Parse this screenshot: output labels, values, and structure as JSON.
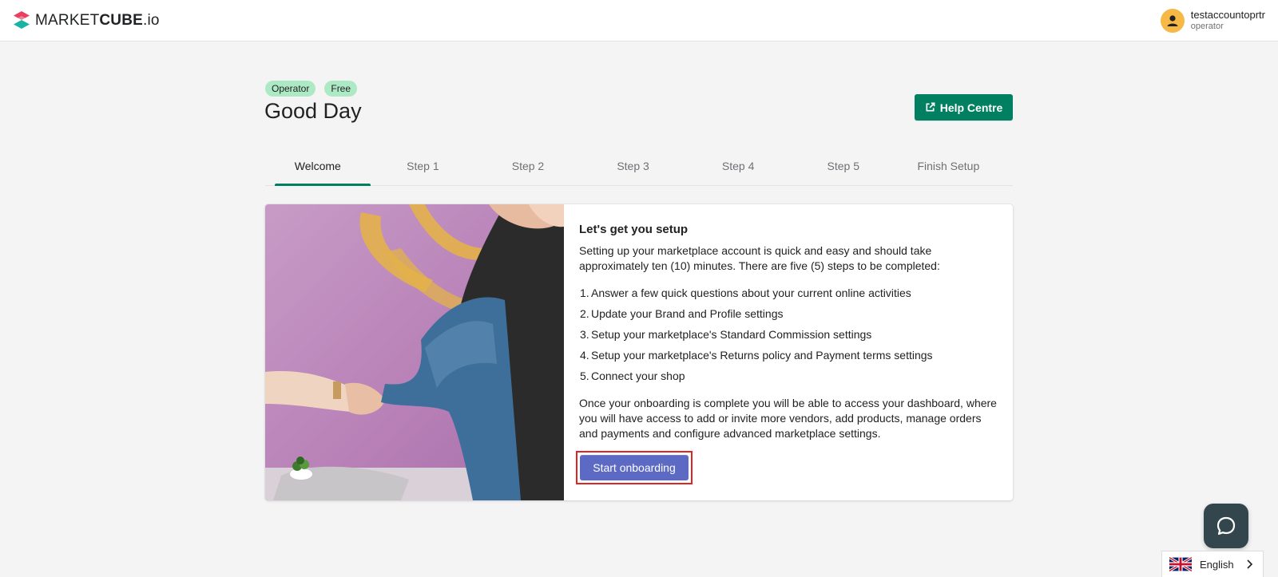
{
  "header": {
    "logo_regular": "MARKET",
    "logo_bold": "CUBE",
    "logo_suffix": ".io",
    "user_name": "testaccountoprtr",
    "user_role": "operator"
  },
  "page": {
    "badges": [
      "Operator",
      "Free"
    ],
    "title": "Good Day",
    "help_button_label": "Help Centre"
  },
  "tabs": [
    {
      "label": "Welcome",
      "active": true
    },
    {
      "label": "Step 1",
      "active": false
    },
    {
      "label": "Step 2",
      "active": false
    },
    {
      "label": "Step 3",
      "active": false
    },
    {
      "label": "Step 4",
      "active": false
    },
    {
      "label": "Step 5",
      "active": false
    },
    {
      "label": "Finish Setup",
      "active": false
    }
  ],
  "card": {
    "heading": "Let's get you setup",
    "intro": "Setting up your marketplace account is quick and easy and should take approximately ten (10) minutes. There are five (5) steps to be completed:",
    "steps": [
      {
        "num": "1.",
        "text": "Answer a few quick questions about your current online activities"
      },
      {
        "num": "2.",
        "text": "Update your Brand and Profile settings"
      },
      {
        "num": "3.",
        "text": "Setup your marketplace's Standard Commission settings"
      },
      {
        "num": "4.",
        "text": "Setup your marketplace's Returns policy and Payment terms settings"
      },
      {
        "num": "5.",
        "text": "Connect your shop"
      }
    ],
    "outro": "Once your onboarding is complete you will be able to access your dashboard, where you will have access to add or invite more vendors, add products, manage orders and payments and configure advanced marketplace settings.",
    "start_button_label": "Start onboarding"
  },
  "language": {
    "label": "English",
    "icon": "uk-flag-icon"
  },
  "colors": {
    "primary_green": "#008060",
    "start_button": "#5c6ac4",
    "badge": "#aee9c5",
    "highlight_border": "#e02424",
    "chat_button": "#33454d"
  }
}
